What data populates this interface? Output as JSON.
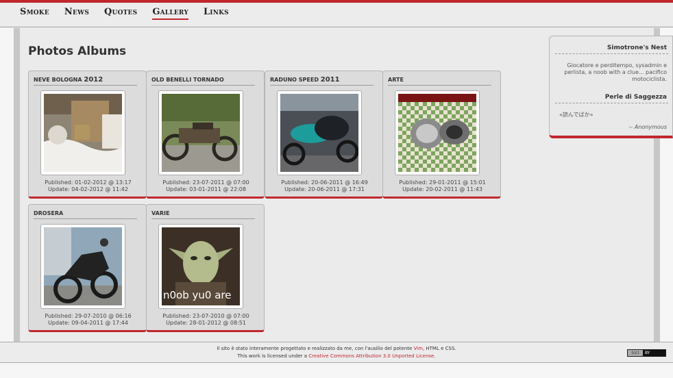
{
  "nav": {
    "items": [
      {
        "label": "Smoke",
        "active": false
      },
      {
        "label": "News",
        "active": false
      },
      {
        "label": "Quotes",
        "active": false
      },
      {
        "label": "Gallery",
        "active": true
      },
      {
        "label": "Links",
        "active": false
      }
    ]
  },
  "page": {
    "title": "Photos Albums"
  },
  "albums": [
    {
      "title": "Neve Bologna",
      "title_year": "2012",
      "published": "Published: 01-02-2012 @ 13:17",
      "updated": "Update: 04-02-2012 @ 11:42",
      "image": "snowy-building-photo"
    },
    {
      "title": "Old Benelli Tornado",
      "title_year": "",
      "published": "Published: 23-07-2011 @ 07:00",
      "updated": "Update: 03-01-2011 @ 22:08",
      "image": "old-motorcycle-photo"
    },
    {
      "title": "Raduno Speed",
      "title_year": "2011",
      "published": "Published: 20-06-2011 @ 16:49",
      "updated": "Update: 20-06-2011 @ 17:31",
      "image": "green-motorcycle-photo"
    },
    {
      "title": "Arte",
      "title_year": "",
      "published": "Published: 29-01-2011 @ 15:01",
      "updated": "Update: 20-02-2011 @ 11:43",
      "image": "metal-sculpture-photo"
    },
    {
      "title": "Drosera",
      "title_year": "",
      "published": "Published: 29-07-2010 @ 06:16",
      "updated": "Update: 09-04-2011 @ 17:44",
      "image": "black-motorcycle-photo"
    },
    {
      "title": "Varie",
      "title_year": "",
      "published": "Published: 23-07-2010 @ 07:00",
      "updated": "Update: 28-01-2012 @ 08:51",
      "image": "yoda-meme-photo",
      "caption": "n0ob yu0 are"
    }
  ],
  "sidebar": {
    "title1": "Simotrone's Nest",
    "desc": "Giocatore e perditempo, sysadmin e perlista, a noob with a clue... pacifico motociclista.",
    "title2": "Perle di Saggezza",
    "quote": "«読んでばか»",
    "author": "-- Anonymous"
  },
  "footer": {
    "line1_pre": "Il sito è stato interamente progettato e realizzato da me, con l'ausilio del potente ",
    "line1_vim": "Vim",
    "line1_post": ", HTML e CSS.",
    "line2_pre": "This work is licensed under a ",
    "line2_link": "Creative Commons Attribution 3.0 Unported License",
    "line2_post": ".",
    "badge_left": "(cc)",
    "badge_right": "BY"
  },
  "colors": {
    "accent": "#c0272d",
    "background": "#ebebeb"
  }
}
